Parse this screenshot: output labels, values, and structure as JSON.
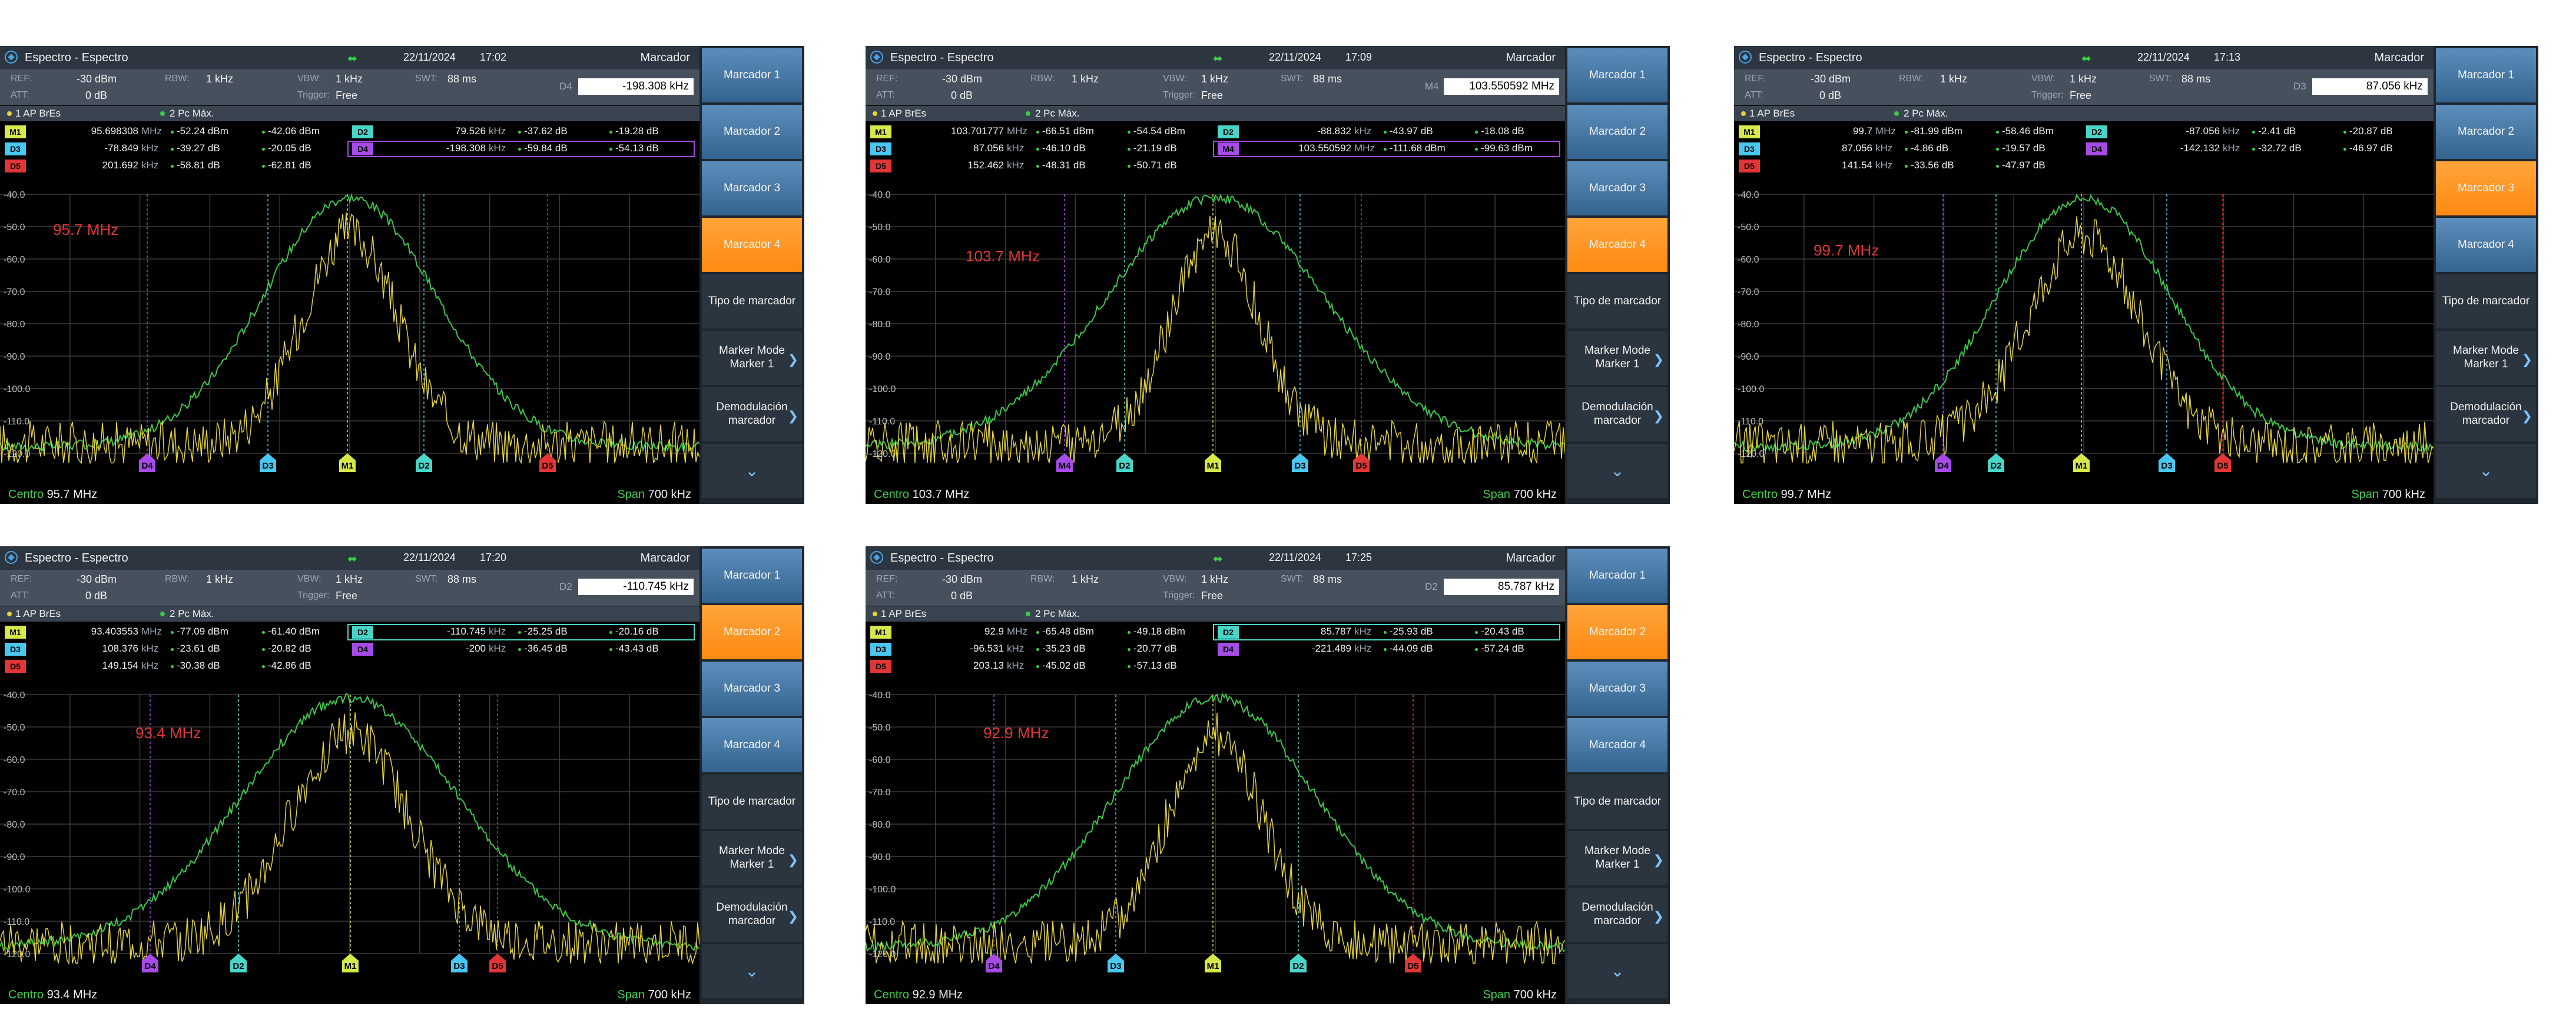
{
  "common": {
    "title": "Espectro - Espectro",
    "header_right": "Marcador",
    "labels": {
      "ref": "REF:",
      "att": "ATT:",
      "rbw": "RBW:",
      "vbw": "VBW:",
      "swt": "SWT:",
      "trigger": "Trigger:"
    },
    "values": {
      "ref": "-30 dBm",
      "att": "0 dB",
      "rbw": "1 kHz",
      "vbw": "1 kHz",
      "swt": "88 ms",
      "trigger": "Free"
    },
    "trace1": "1 AP BrEs",
    "trace2": "2 Pc Máx.",
    "center_label": "Centro",
    "span_label": "Span",
    "span_value": "700 kHz",
    "sidebar": {
      "m1": "Marcador 1",
      "m2": "Marcador 2",
      "m3": "Marcador 3",
      "m4": "Marcador 4",
      "tipo": "Tipo de marcador",
      "mode": "Marker Mode Marker 1",
      "demod": "Demodulación marcador"
    },
    "y_ticks": [
      "-40.0",
      "-50.0",
      "-60.0",
      "-70.0",
      "-80.0",
      "-90.0",
      "-100.0",
      "-110.0",
      "-120.0"
    ],
    "colors": {
      "trace1": "#e3d33a",
      "trace2": "#39c84a",
      "accent": "#ff8f1c",
      "red": "#e23636"
    }
  },
  "panels": [
    {
      "date": "22/11/2024",
      "time": "17:02",
      "active_marker": "Marcador 4",
      "box_label": "D4",
      "box_value": "-198.308 kHz",
      "freq_label": "95.7 MHz",
      "center": "95.7 MHz",
      "rows": [
        {
          "tag": "M1",
          "v1": "95.698308",
          "u1": "MHz",
          "v2": "-52.24 dBm",
          "v3": "-42.06 dBm"
        },
        {
          "tag": "D3",
          "v1": "-78.849",
          "u1": "kHz",
          "v2": "-39.27 dB",
          "v3": "-20.05 dB"
        },
        {
          "tag": "D5",
          "v1": "201.692",
          "u1": "kHz",
          "v2": "-58.81 dB",
          "v3": "-62.81 dB"
        },
        {
          "tag": "D2",
          "v1": "79.526",
          "u1": "kHz",
          "v2": "-37.62 dB",
          "v3": "-19.28 dB"
        },
        {
          "tag": "D4",
          "v1": "-198.308",
          "u1": "kHz",
          "v2": "-59.84 dB",
          "v3": "-54.13 dB"
        }
      ],
      "markers": [
        "D4",
        "D3",
        "M1",
        "D2",
        "D5"
      ]
    },
    {
      "date": "22/11/2024",
      "time": "17:09",
      "active_marker": "Marcador 4",
      "box_label": "M4",
      "box_value": "103.550592 MHz",
      "freq_label": "103.7 MHz",
      "center": "103.7 MHz",
      "rows": [
        {
          "tag": "M1",
          "v1": "103.701777",
          "u1": "MHz",
          "v2": "-66.51 dBm",
          "v3": "-54.54 dBm"
        },
        {
          "tag": "D3",
          "v1": "87.056",
          "u1": "kHz",
          "v2": "-46.10 dB",
          "v3": "-21.19 dB"
        },
        {
          "tag": "D5",
          "v1": "152.462",
          "u1": "kHz",
          "v2": "-48.31 dB",
          "v3": "-50.71 dB"
        },
        {
          "tag": "D2",
          "v1": "-88.832",
          "u1": "kHz",
          "v2": "-43.97 dB",
          "v3": "-18.08 dB"
        },
        {
          "tag": "M4",
          "v1": "103.550592",
          "u1": "MHz",
          "v2": "-111.68 dBm",
          "v3": "-99.63 dBm"
        }
      ],
      "markers": [
        "M4",
        "D2",
        "M1",
        "D3",
        "D5"
      ]
    },
    {
      "date": "22/11/2024",
      "time": "17:13",
      "active_marker": "Marcador 3",
      "box_label": "D3",
      "box_value": "87.056 kHz",
      "freq_label": "99.7 MHz",
      "center": "99.7 MHz",
      "rows": [
        {
          "tag": "M1",
          "v1": "99.7",
          "u1": "MHz",
          "v2": "-81.99 dBm",
          "v3": "-58.46 dBm"
        },
        {
          "tag": "D3",
          "v1": "87.056",
          "u1": "kHz",
          "v2": "-4.86 dB",
          "v3": "-19.57 dB"
        },
        {
          "tag": "D5",
          "v1": "141.54",
          "u1": "kHz",
          "v2": "-33.56 dB",
          "v3": "-47.97 dB"
        },
        {
          "tag": "D2",
          "v1": "-87.056",
          "u1": "kHz",
          "v2": "-2.41 dB",
          "v3": "-20.87 dB"
        },
        {
          "tag": "D4",
          "v1": "-142.132",
          "u1": "kHz",
          "v2": "-32.72 dB",
          "v3": "-46.97 dB"
        }
      ],
      "markers": [
        "D4",
        "D2",
        "M1",
        "D3",
        "D5"
      ]
    },
    {
      "date": "22/11/2024",
      "time": "17:20",
      "active_marker": "Marcador 2",
      "box_label": "D2",
      "box_value": "-110.745 kHz",
      "freq_label": "93.4 MHz",
      "center": "93.4 MHz",
      "rows": [
        {
          "tag": "M1",
          "v1": "93.403553",
          "u1": "MHz",
          "v2": "-77.09 dBm",
          "v3": "-61.40 dBm"
        },
        {
          "tag": "D3",
          "v1": "108.376",
          "u1": "kHz",
          "v2": "-23.61 dB",
          "v3": "-20.82 dB"
        },
        {
          "tag": "D5",
          "v1": "149.154",
          "u1": "kHz",
          "v2": "-30.38 dB",
          "v3": "-42.86 dB"
        },
        {
          "tag": "D2",
          "v1": "-110.745",
          "u1": "kHz",
          "v2": "-25.25 dB",
          "v3": "-20.16 dB"
        },
        {
          "tag": "D4",
          "v1": "-200",
          "u1": "kHz",
          "v2": "-36.45 dB",
          "v3": "-43.43 dB"
        }
      ],
      "markers": [
        "D4",
        "D2",
        "M1",
        "D3",
        "D5"
      ]
    },
    {
      "date": "22/11/2024",
      "time": "17:25",
      "active_marker": "Marcador 2",
      "box_label": "D2",
      "box_value": "85.787 kHz",
      "freq_label": "92.9 MHz",
      "center": "92.9 MHz",
      "rows": [
        {
          "tag": "M1",
          "v1": "92.9",
          "u1": "MHz",
          "v2": "-65.48 dBm",
          "v3": "-49.18 dBm"
        },
        {
          "tag": "D3",
          "v1": "-96.531",
          "u1": "kHz",
          "v2": "-35.23 dB",
          "v3": "-20.77 dB"
        },
        {
          "tag": "D5",
          "v1": "203.13",
          "u1": "kHz",
          "v2": "-45.02 dB",
          "v3": "-57.13 dB"
        },
        {
          "tag": "D2",
          "v1": "85.787",
          "u1": "kHz",
          "v2": "-25.93 dB",
          "v3": "-20.43 dB"
        },
        {
          "tag": "D4",
          "v1": "-221.489",
          "u1": "kHz",
          "v2": "-44.09 dB",
          "v3": "-57.24 dB"
        }
      ],
      "markers": [
        "D4",
        "D3",
        "M1",
        "D2",
        "D5"
      ]
    }
  ]
}
